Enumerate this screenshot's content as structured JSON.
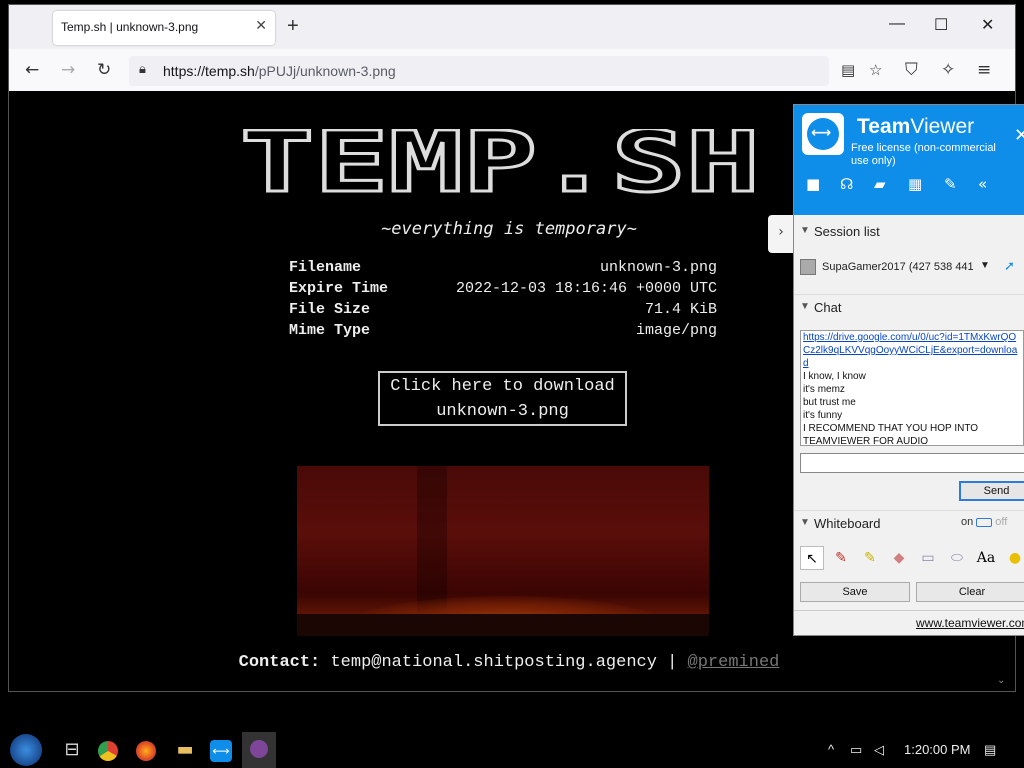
{
  "browser": {
    "tab_title": "Temp.sh | unknown-3.png",
    "tab_close": "✕",
    "new_tab": "+",
    "url_host": "https://temp.sh",
    "url_path": "/pPUJj/unknown-3.png"
  },
  "page": {
    "logo_text": "TEMP.SH",
    "tagline": "~everything is temporary~",
    "info": [
      {
        "key": "Filename",
        "value": "unknown-3.png"
      },
      {
        "key": "Expire Time",
        "value": "2022-12-03 18:16:46 +0000 UTC"
      },
      {
        "key": "File Size",
        "value": "71.4 KiB"
      },
      {
        "key": "Mime Type",
        "value": "image/png"
      }
    ],
    "download_line1": "Click here to download",
    "download_line2": "unknown-3.png",
    "contact_label": "Contact:",
    "contact_email": "temp@national.shitposting.agency",
    "contact_sep": "|",
    "contact_handle": "@premined"
  },
  "teamviewer": {
    "title_bold": "Team",
    "title_rest": "Viewer",
    "subtitle": "Free license (non-commercial use only)",
    "session_list_label": "Session list",
    "session_name": "SupaGamer2017 (427 538 441",
    "chat_label": "Chat",
    "chat_link": "https://drive.google.com/u/0/uc?id=1TMxKwrQOCz2lk9qLKVVqgOoyyWCiCLjE&export=download",
    "chat_messages": [
      "I know, I know",
      "it's memz",
      "but trust me",
      "it's funny",
      "I RECOMMEND THAT YOU HOP INTO TEAMVIEWER FOR AUDIO"
    ],
    "send_label": "Send",
    "whiteboard_label": "Whiteboard",
    "whiteboard_on": "on",
    "whiteboard_off": "off",
    "save_label": "Save",
    "clear_label": "Clear",
    "footer_link": "www.teamviewer.com"
  },
  "taskbar": {
    "clock": "1:20:00 PM"
  },
  "icons": {
    "back": "arrow-left-icon",
    "forward": "arrow-right-icon",
    "reload": "reload-icon",
    "lock": "lock-icon",
    "reader": "reader-view-icon",
    "star": "star-icon",
    "shield": "shield-icon",
    "extensions": "extensions-icon",
    "menu": "menu-icon"
  },
  "colors": {
    "teamviewer_blue": "#0e8ee9",
    "page_bg": "#000000",
    "page_text": "#eeeeee"
  }
}
